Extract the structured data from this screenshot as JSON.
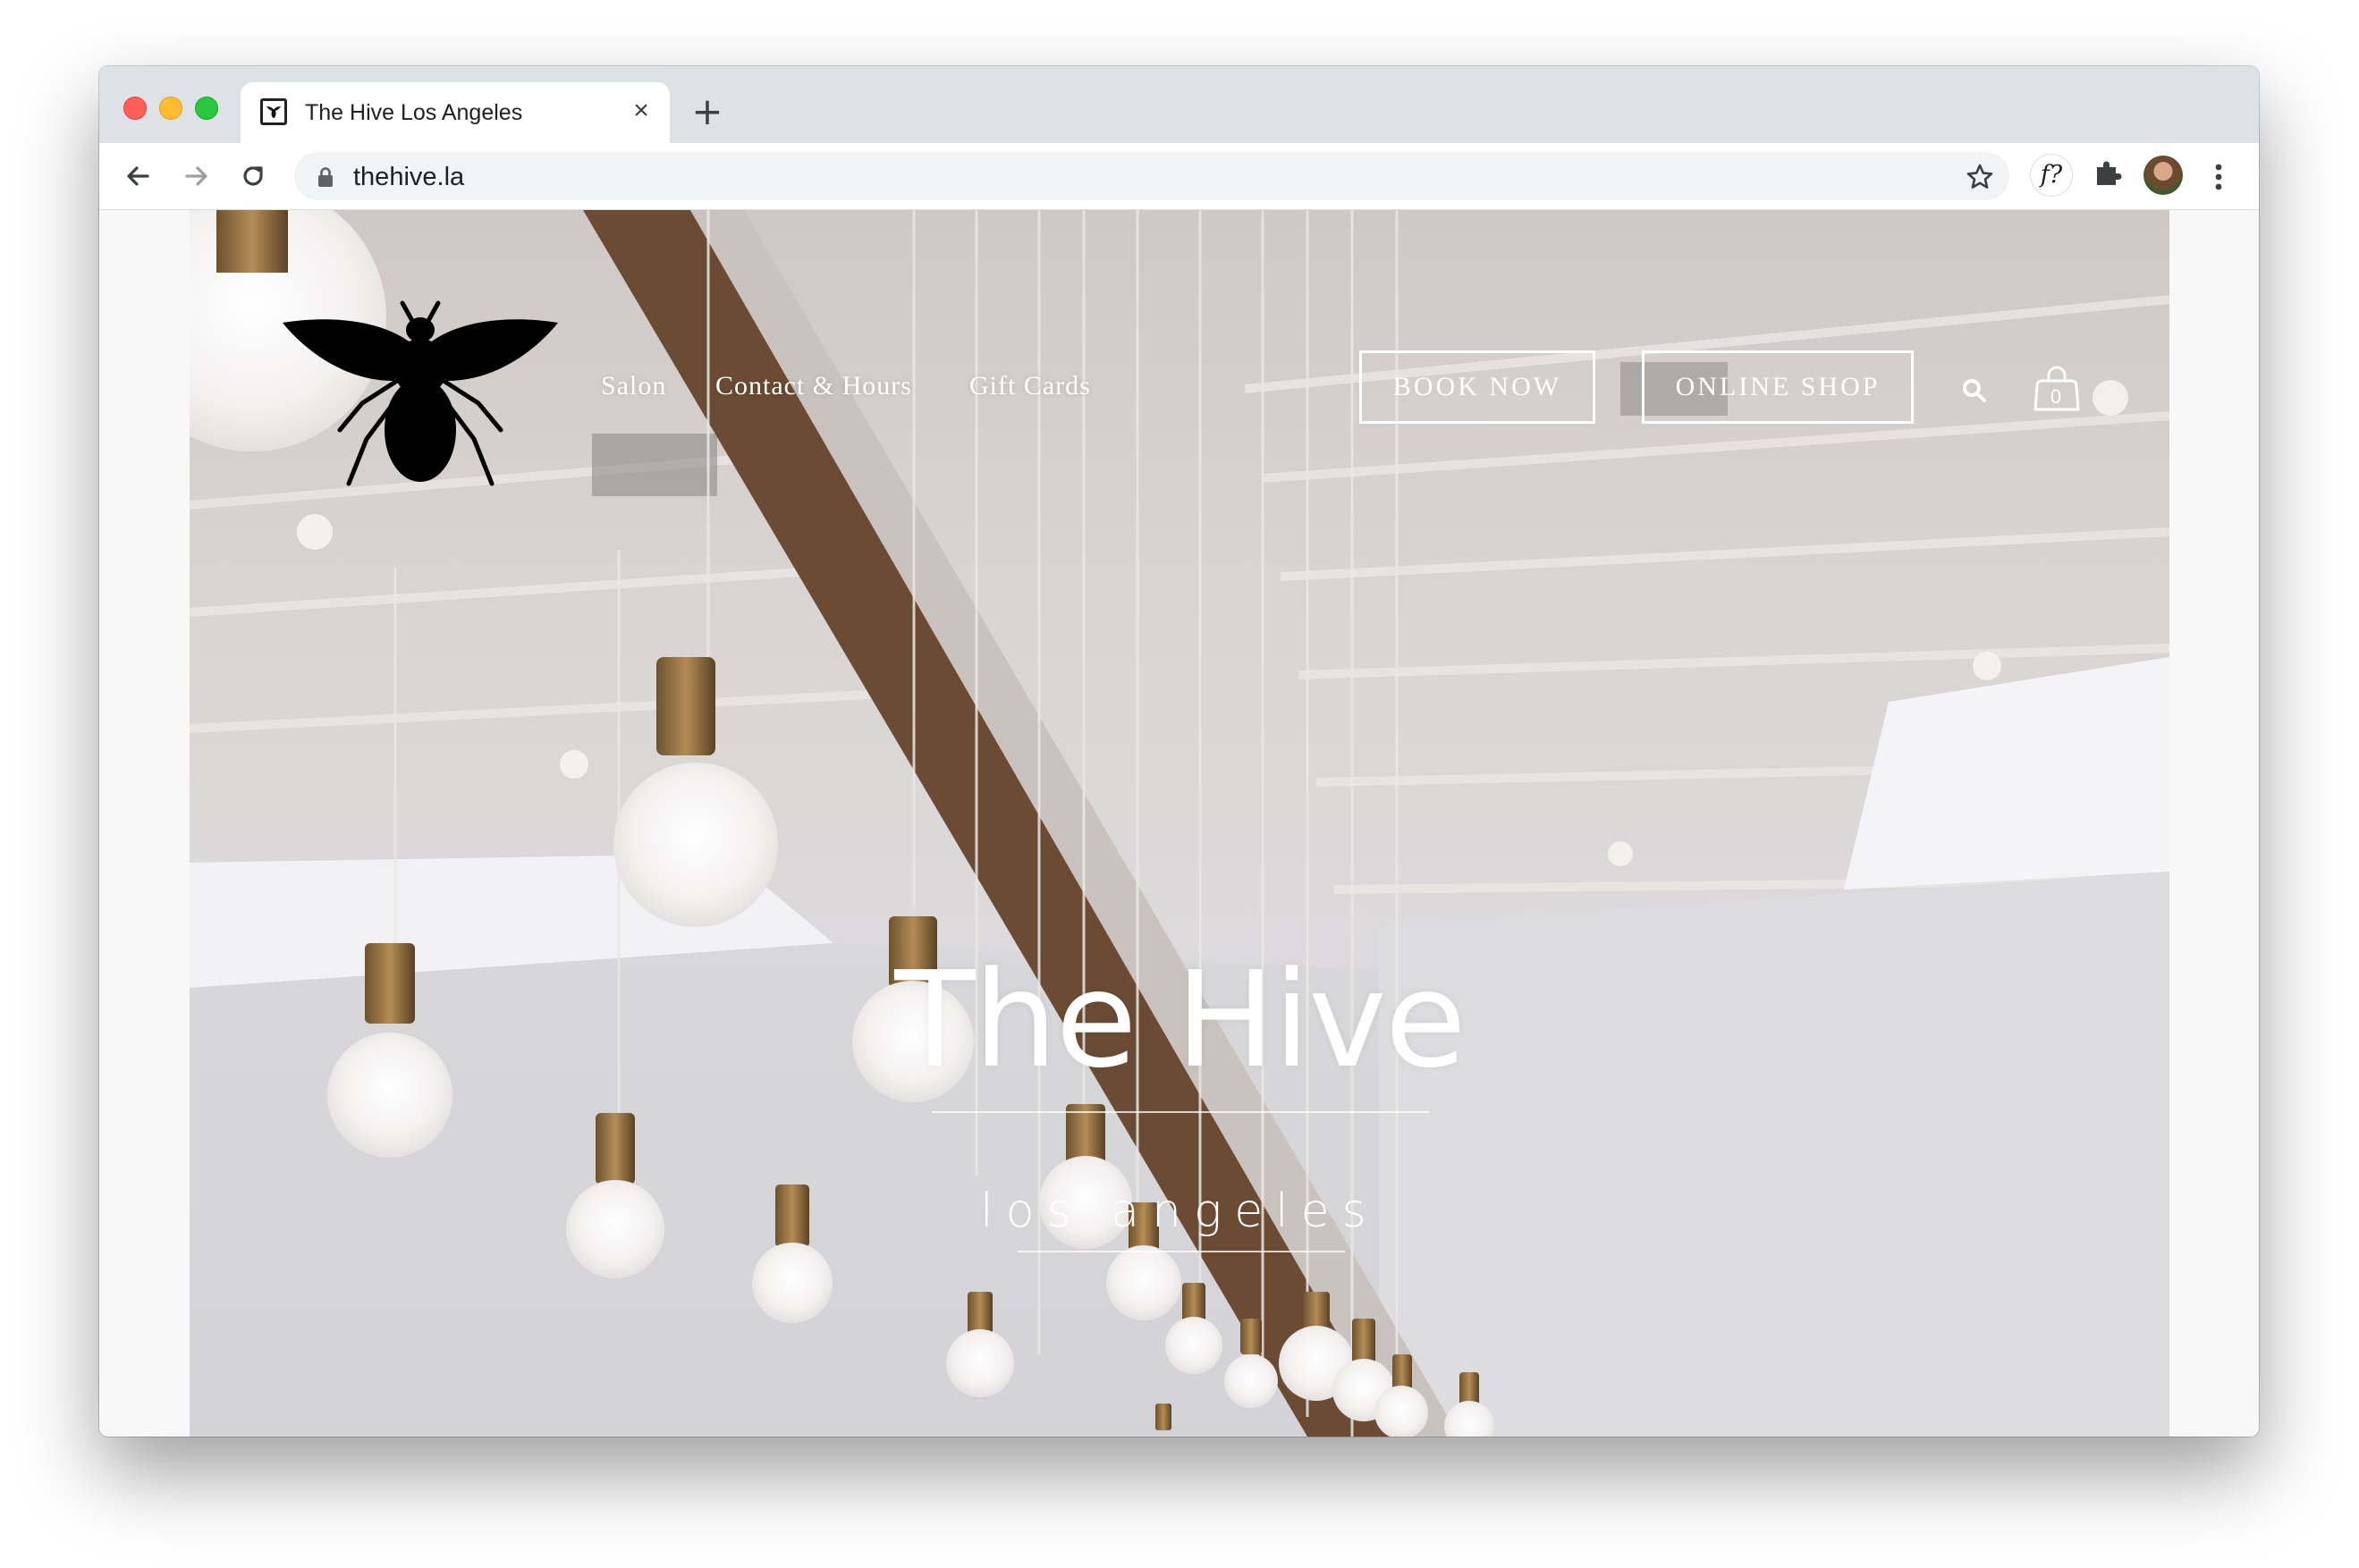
{
  "browser": {
    "tab_title": "The Hive Los Angeles",
    "tab_close": "×",
    "new_tab": "+",
    "url": "thehive.la",
    "extension_label": "f?"
  },
  "site": {
    "nav": [
      {
        "label": "Salon"
      },
      {
        "label": "Contact & Hours"
      },
      {
        "label": "Gift Cards"
      }
    ],
    "book_now": "BOOK NOW",
    "online_shop": "ONLINE SHOP",
    "cart_count": "0",
    "hero_title": "The Hive",
    "hero_subtitle": "los angeles"
  },
  "colors": {
    "tabstrip": "#dee1e6",
    "omnibox": "#f1f3f4",
    "hero_text": "#ffffff",
    "logo": "#000000"
  },
  "icons": [
    "back-arrow-icon",
    "forward-arrow-icon",
    "reload-icon",
    "lock-icon",
    "star-icon",
    "puzzle-icon",
    "menu-dots-icon",
    "bee-logo",
    "search-icon",
    "shopping-bag-icon"
  ]
}
